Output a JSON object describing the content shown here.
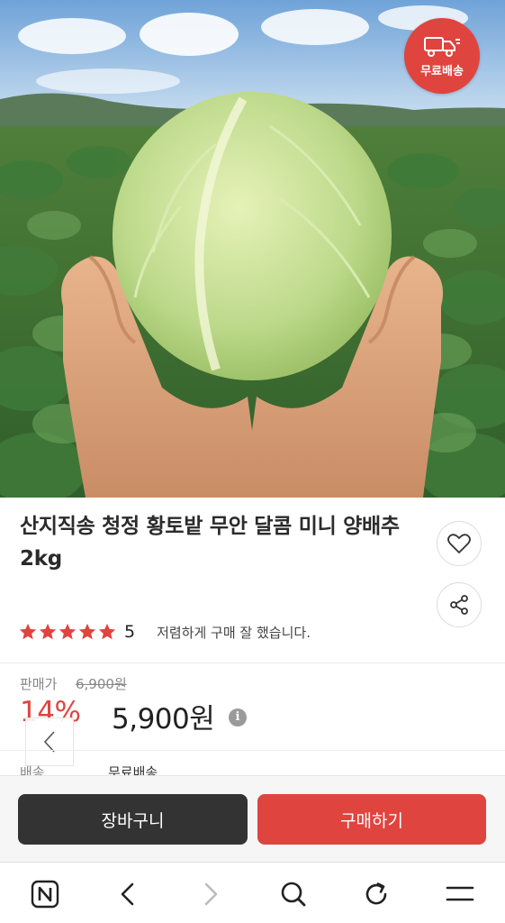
{
  "hero": {
    "badge_label": "무료배송",
    "badge_icon": "delivery-truck-icon",
    "colors": {
      "badge": "#e0443f"
    }
  },
  "product": {
    "title": "산지직송 청정 황토밭 무안 달콤 미니 양배추 2kg",
    "rating": 5,
    "rating_text": "5",
    "review_snippet": "저렴하게 구매 잘 했습니다.",
    "star_color": "#e0443f"
  },
  "price": {
    "label": "판매가",
    "original": "6,900원",
    "discount": "14%",
    "sale": "5,900원",
    "info_icon_text": "i"
  },
  "shipping": {
    "label": "배송",
    "value": "무료배송"
  },
  "actions": {
    "cart_label": "장바구니",
    "buy_label": "구매하기",
    "colors": {
      "cart": "#333333",
      "buy": "#e0443f"
    }
  },
  "browser_nav": {
    "items": [
      "naver-home-icon",
      "back-icon",
      "forward-icon",
      "search-icon",
      "refresh-icon",
      "menu-icon"
    ],
    "home_letter": "N"
  }
}
